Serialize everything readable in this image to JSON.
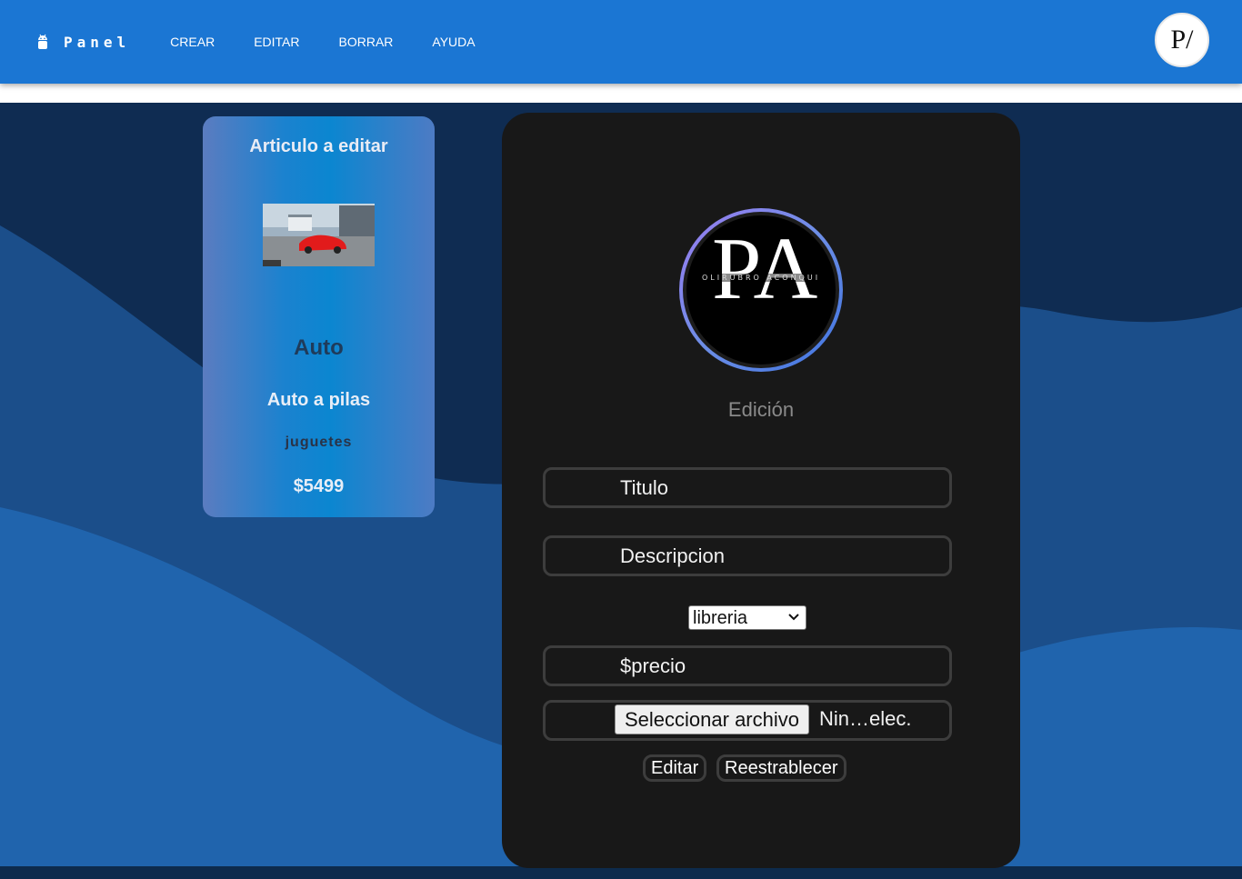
{
  "navbar": {
    "brand": "Panel",
    "links": [
      "CREAR",
      "EDITAR",
      "BORRAR",
      "AYUDA"
    ],
    "logo_text": "P/",
    "colors": {
      "bar": "#1b76d3",
      "text": "#ffffff"
    }
  },
  "preview": {
    "heading": "Articulo a editar",
    "title": "Auto",
    "description": "Auto a pilas",
    "category": "juguetes",
    "price": "$5499"
  },
  "form": {
    "logo_letters": "PA",
    "logo_ring_text": "OLIRUBRO ACONQUI",
    "heading": "Edición",
    "titulo_placeholder": "Titulo",
    "descripcion_placeholder": "Descripcion",
    "category_selected": "libreria",
    "precio_placeholder": "$precio",
    "file_button": "Seleccionar archivo",
    "file_status": "Nin…elec.",
    "edit_button": "Editar",
    "reset_button": "Reestrablecer"
  },
  "icons": {
    "brand": "android-icon",
    "select": "chevron-down-icon"
  }
}
